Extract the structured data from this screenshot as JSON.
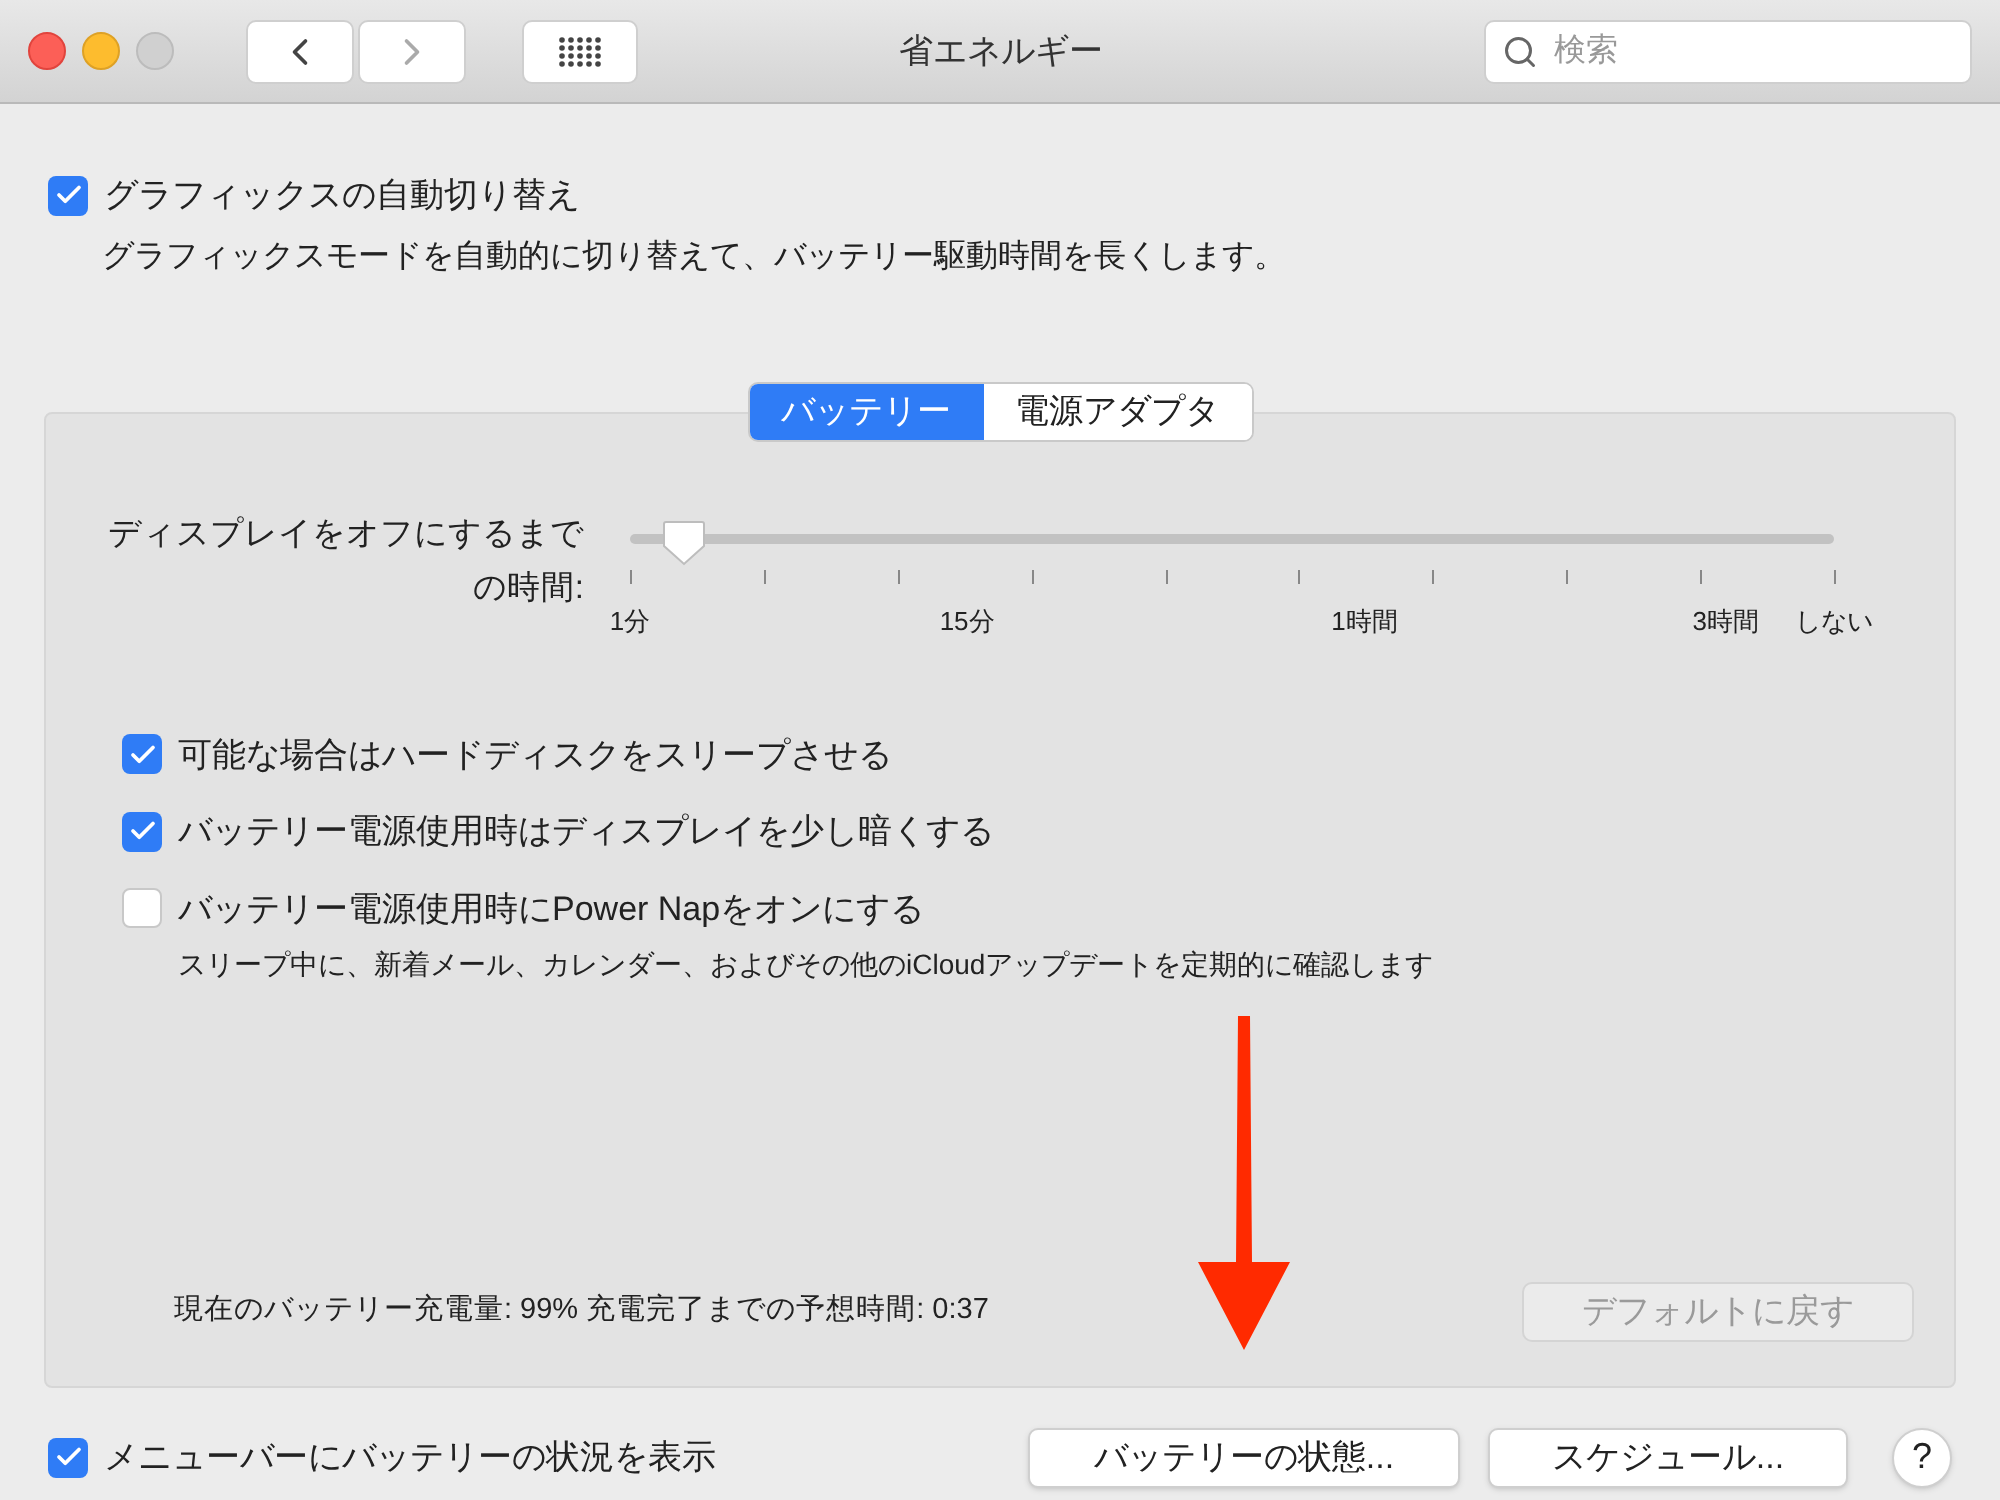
{
  "window": {
    "title": "省エネルギー",
    "search": {
      "placeholder": "検索"
    }
  },
  "top_option": {
    "label": "グラフィックスの自動切り替え",
    "checked": true,
    "description": "グラフィックスモードを自動的に切り替えて、バッテリー駆動時間を長くします。"
  },
  "tabs": [
    {
      "label": "バッテリー",
      "selected": true
    },
    {
      "label": "電源アダプタ",
      "selected": false
    }
  ],
  "slider": {
    "label": "ディスプレイをオフにするまでの時間:",
    "level": 0.045,
    "tick_labels": [
      "1分",
      "15分",
      "1時間",
      "3時間",
      "しない"
    ]
  },
  "options": [
    {
      "label": "可能な場合はハードディスクをスリープさせる",
      "checked": true
    },
    {
      "label": "バッテリー電源使用時はディスプレイを少し暗くする",
      "checked": true
    },
    {
      "label": "バッテリー電源使用時にPower Napをオンにする",
      "checked": false,
      "description": "スリープ中に、新着メール、カレンダー、およびその他のiCloudアップデートを定期的に確認します"
    }
  ],
  "status": "現在のバッテリー充電量: 99% 充電完了までの予想時間: 0:37",
  "default_button": {
    "label": "デフォルトに戻す",
    "disabled": true
  },
  "bottom_option": {
    "label": "メニューバーにバッテリーの状況を表示",
    "checked": true
  },
  "buttons": [
    "バッテリーの状態...",
    "スケジュール..."
  ],
  "help": "?"
}
